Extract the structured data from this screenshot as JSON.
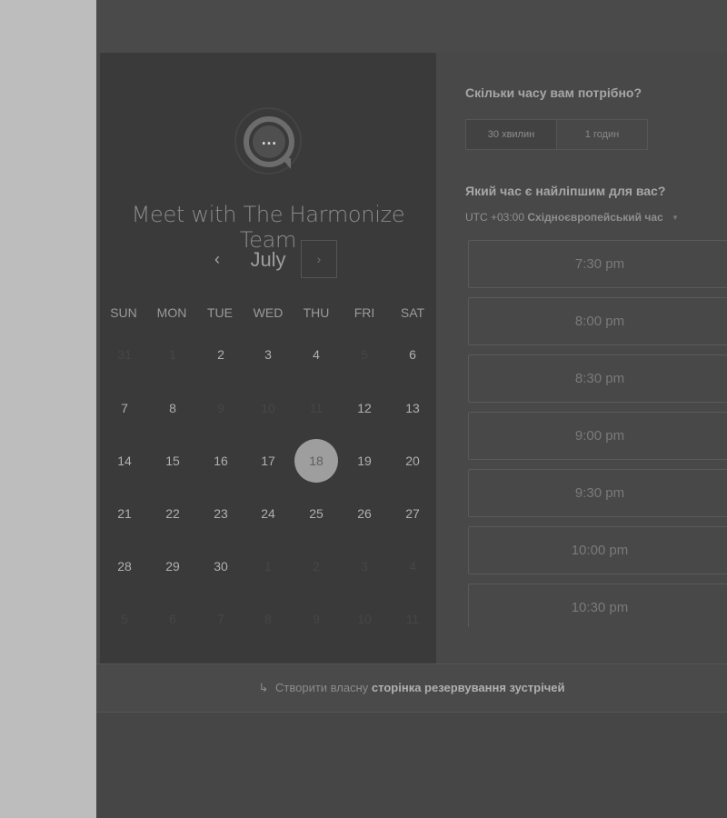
{
  "header": {
    "clipped_text": ""
  },
  "calendar": {
    "title": "Meet with The Harmonize Team",
    "month": "July",
    "prev_icon": "‹",
    "next_icon": "›",
    "weekdays": [
      "SUN",
      "MON",
      "TUE",
      "WED",
      "THU",
      "FRI",
      "SAT"
    ],
    "weeks": [
      [
        {
          "d": "31",
          "s": "disabled"
        },
        {
          "d": "1",
          "s": "disabled"
        },
        {
          "d": "2",
          "s": "available"
        },
        {
          "d": "3",
          "s": "available"
        },
        {
          "d": "4",
          "s": "available"
        },
        {
          "d": "5",
          "s": "disabled"
        },
        {
          "d": "6",
          "s": "available"
        }
      ],
      [
        {
          "d": "7",
          "s": "available"
        },
        {
          "d": "8",
          "s": "available"
        },
        {
          "d": "9",
          "s": "disabled"
        },
        {
          "d": "10",
          "s": "disabled"
        },
        {
          "d": "11",
          "s": "disabled"
        },
        {
          "d": "12",
          "s": "available"
        },
        {
          "d": "13",
          "s": "available"
        }
      ],
      [
        {
          "d": "14",
          "s": "available"
        },
        {
          "d": "15",
          "s": "available"
        },
        {
          "d": "16",
          "s": "available"
        },
        {
          "d": "17",
          "s": "available"
        },
        {
          "d": "18",
          "s": "selected"
        },
        {
          "d": "19",
          "s": "available"
        },
        {
          "d": "20",
          "s": "available"
        }
      ],
      [
        {
          "d": "21",
          "s": "available"
        },
        {
          "d": "22",
          "s": "available"
        },
        {
          "d": "23",
          "s": "available"
        },
        {
          "d": "24",
          "s": "available"
        },
        {
          "d": "25",
          "s": "available"
        },
        {
          "d": "26",
          "s": "available"
        },
        {
          "d": "27",
          "s": "available"
        }
      ],
      [
        {
          "d": "28",
          "s": "available"
        },
        {
          "d": "29",
          "s": "available"
        },
        {
          "d": "30",
          "s": "available"
        },
        {
          "d": "1",
          "s": "disabled"
        },
        {
          "d": "2",
          "s": "disabled"
        },
        {
          "d": "3",
          "s": "disabled"
        },
        {
          "d": "4",
          "s": "disabled"
        }
      ],
      [
        {
          "d": "5",
          "s": "disabled"
        },
        {
          "d": "6",
          "s": "disabled"
        },
        {
          "d": "7",
          "s": "disabled"
        },
        {
          "d": "8",
          "s": "disabled"
        },
        {
          "d": "9",
          "s": "disabled"
        },
        {
          "d": "10",
          "s": "disabled"
        },
        {
          "d": "11",
          "s": "disabled"
        }
      ]
    ]
  },
  "booking": {
    "duration_question": "Скільки часу вам потрібно?",
    "duration_options": [
      "30 хвилин",
      "1 годин"
    ],
    "selected_duration": "30 хвилин",
    "time_question": "Який час є найліпшим для вас?",
    "timezone_offset": "UTC +03:00",
    "timezone_name": "Східноєвропейський час",
    "slots": [
      "7:30 pm",
      "8:00 pm",
      "8:30 pm",
      "9:00 pm",
      "9:30 pm",
      "10:00 pm",
      "10:30 pm"
    ]
  },
  "footer": {
    "icon": "↳",
    "prefix": "Створити власну",
    "link": "сторінка резервування зустрічей"
  },
  "colors": {
    "left_panel": "#3a3a3a",
    "right_panel": "#484848",
    "selected_day": "#9e9e9e",
    "side_margin": "#bdbdbd"
  }
}
